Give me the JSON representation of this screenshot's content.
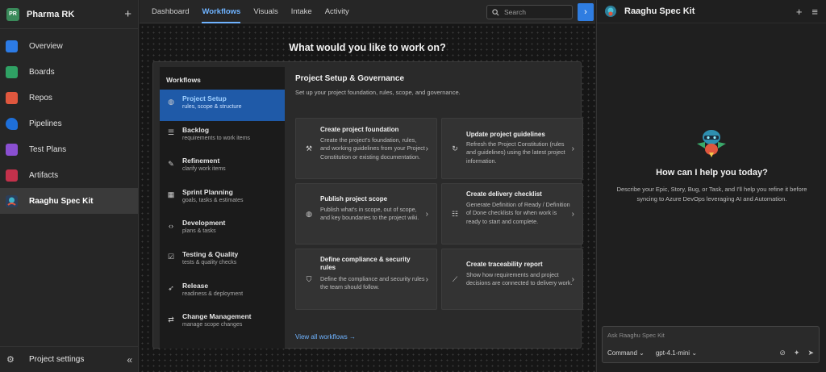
{
  "sidebar": {
    "project_initials": "PR",
    "project_name": "Pharma RK",
    "add_icon": "plus-icon",
    "items": [
      {
        "label": "Overview",
        "icon": "overview-icon"
      },
      {
        "label": "Boards",
        "icon": "boards-icon"
      },
      {
        "label": "Repos",
        "icon": "repos-icon"
      },
      {
        "label": "Pipelines",
        "icon": "pipelines-icon"
      },
      {
        "label": "Test Plans",
        "icon": "test-plans-icon"
      },
      {
        "label": "Artifacts",
        "icon": "artifacts-icon"
      },
      {
        "label": "Raaghu Spec Kit",
        "icon": "spec-kit-icon",
        "selected": true
      }
    ],
    "footer": {
      "label": "Project settings",
      "icon": "gear-icon",
      "collapse_icon": "double-chevron-left-icon"
    }
  },
  "topbar": {
    "tabs": [
      "Dashboard",
      "Workflows",
      "Visuals",
      "Intake",
      "Activity"
    ],
    "active_tab": "Workflows",
    "search_placeholder": "Search"
  },
  "main": {
    "heading": "What would you like to work on?",
    "workflows_header": "Workflows",
    "workflows": [
      {
        "title": "Project Setup",
        "subtitle": "rules, scope & structure",
        "icon": "globe-icon",
        "selected": true
      },
      {
        "title": "Backlog",
        "subtitle": "requirements to work items",
        "icon": "list-icon"
      },
      {
        "title": "Refinement",
        "subtitle": "clarify work items",
        "icon": "pencil-icon"
      },
      {
        "title": "Sprint Planning",
        "subtitle": "goals, tasks & estimates",
        "icon": "calendar-icon"
      },
      {
        "title": "Development",
        "subtitle": "plans & tasks",
        "icon": "code-icon"
      },
      {
        "title": "Testing & Quality",
        "subtitle": "tests & quality checks",
        "icon": "checklist-icon"
      },
      {
        "title": "Release",
        "subtitle": "readiness & deployment",
        "icon": "rocket-icon"
      },
      {
        "title": "Change Management",
        "subtitle": "manage scope changes",
        "icon": "change-icon"
      }
    ],
    "detail_title": "Project Setup & Governance",
    "detail_description": "Set up your project foundation, rules, scope, and governance.",
    "cards": [
      {
        "title": "Create project foundation",
        "description": "Create the project's foundation, rules, and working guidelines from your Project Constitution or existing documentation.",
        "icon": "hammer-icon"
      },
      {
        "title": "Update project guidelines",
        "description": "Refresh the Project Constitution (rules and guidelines) using the latest project information.",
        "icon": "refresh-icon"
      },
      {
        "title": "Publish project scope",
        "description": "Publish what's in scope, out of scope, and key boundaries to the project wiki.",
        "icon": "globe-icon"
      },
      {
        "title": "Create delivery checklist",
        "description": "Generate Definition of Ready / Definition of Done checklists for when work is ready to start and complete.",
        "icon": "checklist-icon"
      },
      {
        "title": "Define compliance & security rules",
        "description": "Define the compliance and security rules the team should follow.",
        "icon": "shield-icon"
      },
      {
        "title": "Create traceability report",
        "description": "Show how requirements and project decisions are connected to delivery work.",
        "icon": "trend-icon"
      }
    ],
    "view_all": "View all workflows →"
  },
  "assistant": {
    "title": "Raaghu Spec Kit",
    "greeting": "How can I help you today?",
    "description": "Describe your Epic, Story, Bug, or Task, and I'll help you refine it before syncing to Azure DevOps leveraging AI and Automation.",
    "input_placeholder": "Ask Raaghu Spec Kit",
    "mode": "Command",
    "model": "gpt-4.1-mini"
  },
  "colors": {
    "accent": "#2f7de1",
    "link": "#6fb3ff",
    "selected_workflow": "#1f5aa8"
  }
}
